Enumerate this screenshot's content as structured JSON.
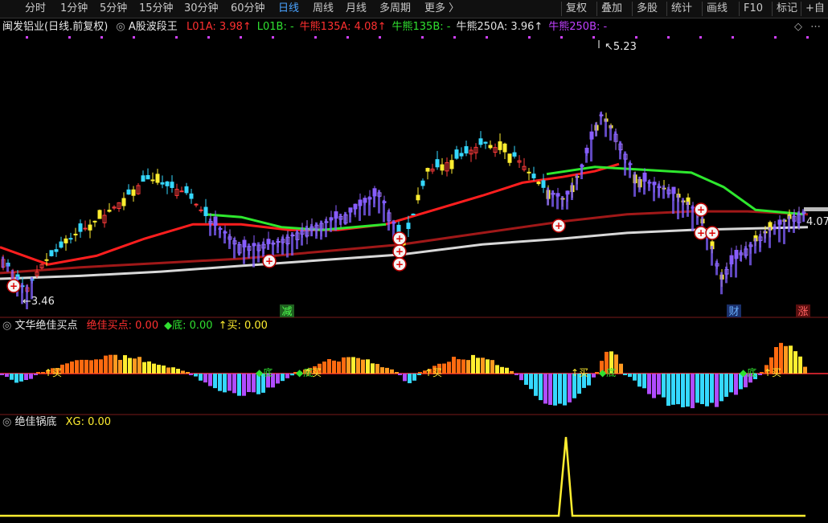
{
  "toolbar": {
    "periods": [
      "分时",
      "1分钟",
      "5分钟",
      "15分钟",
      "30分钟",
      "60分钟",
      "日线",
      "周线",
      "月线",
      "多周期",
      "更多 〉"
    ],
    "active_period": "日线",
    "tools": [
      "复权",
      "叠加",
      "多股",
      "统计",
      "画线",
      "F10",
      "标记",
      "+自"
    ]
  },
  "main_panel": {
    "title": "闽发铝业(日线.前复权)",
    "indicator_name": "A股波段王",
    "readouts": [
      {
        "text": "L01A: 3.98↑",
        "color": "#ff3030"
      },
      {
        "text": "L01B: -",
        "color": "#30e030"
      },
      {
        "text": "牛熊135A: 4.08↑",
        "color": "#ff3030"
      },
      {
        "text": "牛熊135B: -",
        "color": "#30e030"
      },
      {
        "text": "牛熊250A: 3.96↑",
        "color": "#e0e0e0"
      },
      {
        "text": "牛熊250B: -",
        "color": "#c040ff"
      }
    ],
    "high_label": "5.23",
    "low_label": "3.46",
    "last_label": "4.07",
    "markers": [
      "减",
      "财",
      "涨"
    ]
  },
  "panel2": {
    "title": "文华绝佳买点",
    "readouts": [
      {
        "text": "绝佳买点: 0.00",
        "color": "#ff3030"
      },
      {
        "text": "◆底: 0.00",
        "color": "#30e030"
      },
      {
        "text": "↑买: 0.00",
        "color": "#ffee30"
      }
    ],
    "signal_labels": [
      "↑买",
      "◆底",
      "◆底",
      "↑买",
      "↑买",
      "◆底",
      "↑买",
      "◆底",
      "↑买"
    ]
  },
  "panel3": {
    "title": "绝佳锅底",
    "readouts": [
      {
        "text": "XG: 0.00",
        "color": "#ffee30"
      }
    ]
  },
  "colors": {
    "up": "#ff3b3b",
    "down": "#35d8ff",
    "yellow": "#ffee30",
    "purple": "#9a5cff",
    "ma_red": "#ff1e1e",
    "ma_green": "#2ee82e",
    "ma_dark": "#a01818",
    "ma_white": "#d8d8d8"
  }
}
